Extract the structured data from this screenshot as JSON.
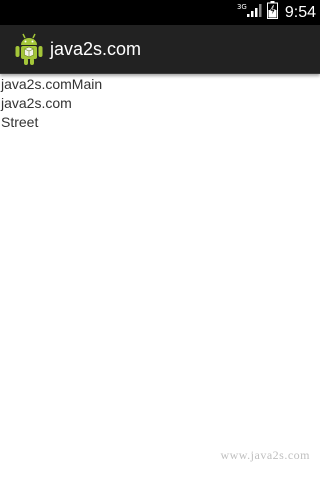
{
  "status_bar": {
    "network_type": "3G",
    "time": "9:54",
    "signal_icon": "signal-bars-icon",
    "battery_icon": "battery-charging-icon"
  },
  "action_bar": {
    "app_icon": "android-robot-icon",
    "title": "java2s.com"
  },
  "content": {
    "lines": [
      "java2s.comMain",
      "java2s.com",
      "Street"
    ]
  },
  "watermark": "www.java2s.com",
  "colors": {
    "status_bar_bg": "#000000",
    "action_bar_bg": "#222222",
    "content_bg": "#ffffff",
    "text": "#333333",
    "android_green": "#8bc34a"
  }
}
